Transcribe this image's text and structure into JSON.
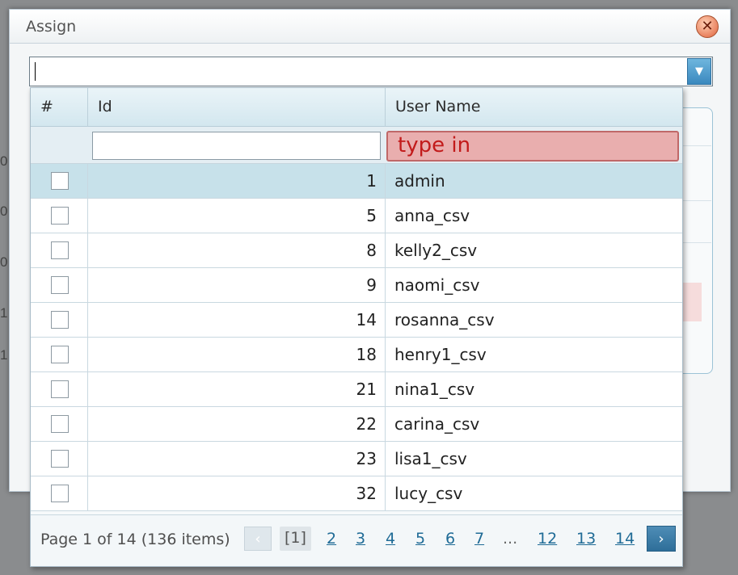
{
  "dialog": {
    "title": "Assign",
    "close_icon": "close-icon"
  },
  "combo": {
    "value": "",
    "arrow_icon": "chevron-down-icon"
  },
  "grid": {
    "columns": [
      "#",
      "Id",
      "User Name"
    ],
    "filter": {
      "id_value": "",
      "name_placeholder": "type in"
    },
    "rows": [
      {
        "id": "1",
        "name": "admin",
        "selected": true
      },
      {
        "id": "5",
        "name": "anna_csv"
      },
      {
        "id": "8",
        "name": "kelly2_csv"
      },
      {
        "id": "9",
        "name": "naomi_csv"
      },
      {
        "id": "14",
        "name": "rosanna_csv"
      },
      {
        "id": "18",
        "name": "henry1_csv"
      },
      {
        "id": "21",
        "name": "nina1_csv"
      },
      {
        "id": "22",
        "name": "carina_csv"
      },
      {
        "id": "23",
        "name": "lisa1_csv"
      },
      {
        "id": "32",
        "name": "lucy_csv"
      }
    ]
  },
  "pager": {
    "info": "Page 1 of 14 (136 items)",
    "prev_icon": "chevron-left-icon",
    "next_icon": "chevron-right-icon",
    "current": "[1]",
    "pages": [
      "2",
      "3",
      "4",
      "5",
      "6",
      "7"
    ],
    "ellipsis": "...",
    "tail_pages": [
      "12",
      "13",
      "14"
    ]
  },
  "background": {
    "side_digits": [
      "0",
      "0",
      "0",
      "1",
      "1"
    ]
  },
  "colors": {
    "accent": "#3a88be",
    "selected_row": "#c7e1ea",
    "highlight_filter": "#e9aeae",
    "highlight_text": "#c21b1b"
  }
}
